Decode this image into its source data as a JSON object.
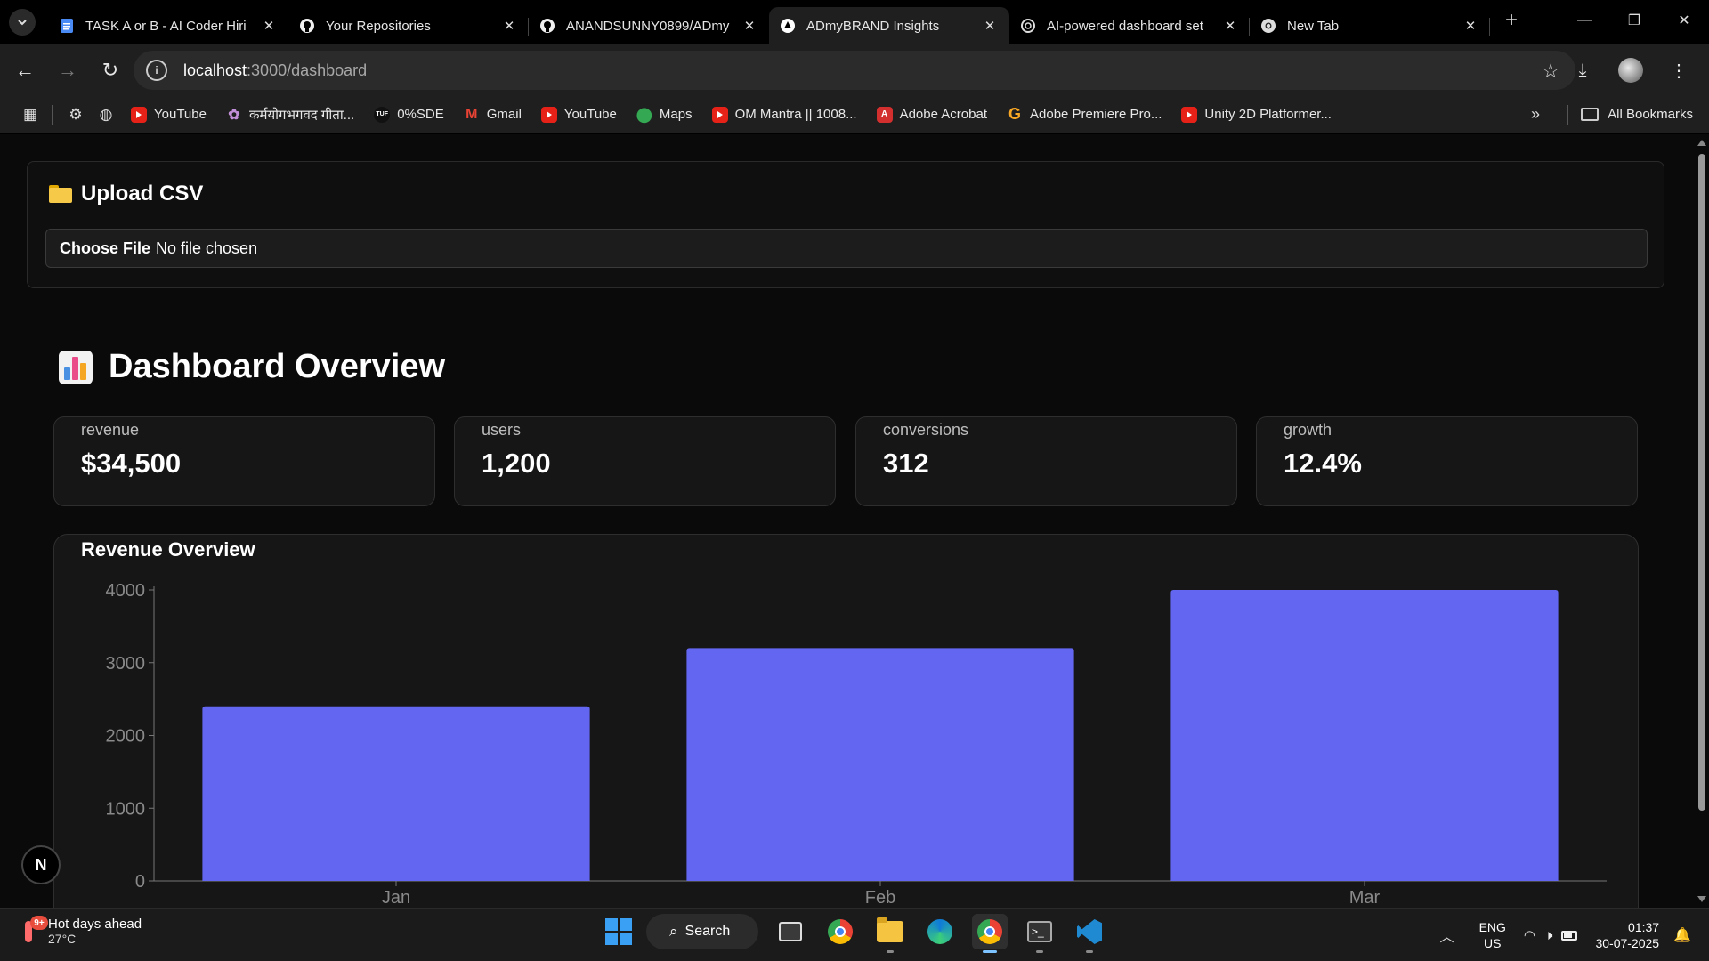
{
  "browser": {
    "tabs": [
      {
        "title": "TASK A or B - AI Coder Hiri",
        "icon": "docs-icon",
        "active": false
      },
      {
        "title": "Your Repositories",
        "icon": "github-icon",
        "active": false
      },
      {
        "title": "ANANDSUNNY0899/ADmy",
        "icon": "github-icon",
        "active": false
      },
      {
        "title": "ADmyBRAND Insights",
        "icon": "triangle-icon",
        "active": true
      },
      {
        "title": "AI-powered dashboard set",
        "icon": "chatgpt-icon",
        "active": false
      },
      {
        "title": "New Tab",
        "icon": "chrome-icon",
        "active": false
      }
    ],
    "url_host": "localhost",
    "url_path": ":3000/dashboard",
    "bookmarks": [
      {
        "label": "YouTube",
        "icon": "youtube-icon"
      },
      {
        "label": "कर्मयोगभगवद गीता...",
        "icon": "lotus-icon"
      },
      {
        "label": "0%SDE",
        "icon": "tuf-icon"
      },
      {
        "label": "Gmail",
        "icon": "gmail-icon"
      },
      {
        "label": "YouTube",
        "icon": "youtube-icon"
      },
      {
        "label": "Maps",
        "icon": "maps-icon"
      },
      {
        "label": "OM Mantra || 1008...",
        "icon": "youtube-icon"
      },
      {
        "label": "Adobe Acrobat",
        "icon": "acrobat-icon"
      },
      {
        "label": "Adobe Premiere Pro...",
        "icon": "google-icon"
      },
      {
        "label": "Unity 2D Platformer...",
        "icon": "youtube-icon"
      }
    ],
    "all_bookmarks_label": "All Bookmarks"
  },
  "page": {
    "upload": {
      "title": "Upload CSV",
      "choose_label": "Choose File",
      "file_status": "No file chosen"
    },
    "overview_title": "Dashboard Overview",
    "stats": [
      {
        "label": "revenue",
        "value": "$34,500"
      },
      {
        "label": "users",
        "value": "1,200"
      },
      {
        "label": "conversions",
        "value": "312"
      },
      {
        "label": "growth",
        "value": "12.4%"
      }
    ],
    "chart_title": "Revenue Overview",
    "next_badge": "N"
  },
  "chart_data": {
    "type": "bar",
    "title": "Revenue Overview",
    "categories": [
      "Jan",
      "Feb",
      "Mar"
    ],
    "values": [
      2400,
      3200,
      4000
    ],
    "yticks": [
      0,
      1000,
      2000,
      3000,
      4000
    ],
    "ylim": [
      0,
      4000
    ],
    "grid": false,
    "bar_color": "#6366f1"
  },
  "taskbar": {
    "weather_title": "Hot days ahead",
    "weather_temp": "27°C",
    "weather_badge": "9+",
    "search_label": "Search",
    "lang_line1": "ENG",
    "lang_line2": "US",
    "time": "01:37",
    "date": "30-07-2025"
  },
  "colors": {
    "accent": "#6366f1",
    "page_bg": "#0a0a0a",
    "card_bg": "#161616"
  }
}
